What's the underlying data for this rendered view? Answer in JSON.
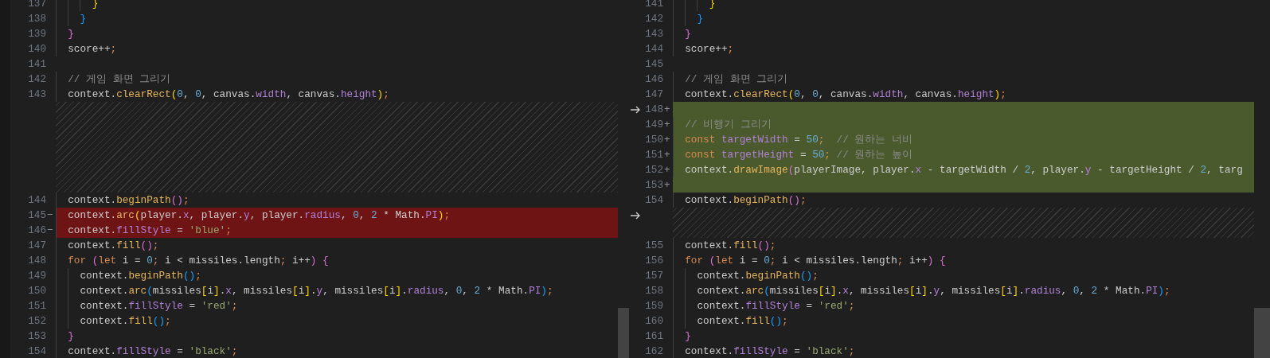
{
  "panes": [
    {
      "kind": "original",
      "lines": [
        {
          "kind": "code",
          "number": "137",
          "tokens": [
            {
              "text": "      }",
              "kind": "bracket_gold"
            }
          ]
        },
        {
          "kind": "code",
          "number": "138",
          "tokens": [
            {
              "text": "    }",
              "kind": "bracket_blue"
            }
          ]
        },
        {
          "kind": "code",
          "number": "139",
          "tokens": [
            {
              "text": "  }",
              "kind": "bracket_pink"
            }
          ]
        },
        {
          "kind": "code",
          "number": "140",
          "tokens": [
            {
              "text": "  score++",
              "kind": "plain"
            },
            {
              "text": ";",
              "kind": "punctuation"
            }
          ]
        },
        {
          "kind": "code",
          "number": "141"
        },
        {
          "kind": "code",
          "number": "142",
          "tokens": [
            {
              "text": "  // 게임 화면 그리기",
              "kind": "comment"
            }
          ]
        },
        {
          "kind": "code",
          "number": "143",
          "tokens": [
            {
              "text": "  context.",
              "kind": "plain"
            },
            {
              "text": "clearRect",
              "kind": "function"
            },
            {
              "text": "(",
              "kind": "bracket_gold"
            },
            {
              "text": "0",
              "kind": "number"
            },
            {
              "text": ", ",
              "kind": "plain"
            },
            {
              "text": "0",
              "kind": "number"
            },
            {
              "text": ", canvas.",
              "kind": "plain"
            },
            {
              "text": "width",
              "kind": "property"
            },
            {
              "text": ", canvas.",
              "kind": "plain"
            },
            {
              "text": "height",
              "kind": "property"
            },
            {
              "text": ")",
              "kind": "bracket_gold"
            },
            {
              "text": ";",
              "kind": "punctuation"
            }
          ]
        },
        {
          "kind": "filler"
        },
        {
          "kind": "filler"
        },
        {
          "kind": "filler"
        },
        {
          "kind": "filler"
        },
        {
          "kind": "filler"
        },
        {
          "kind": "filler"
        },
        {
          "kind": "code",
          "number": "144",
          "tokens": [
            {
              "text": "  context.",
              "kind": "plain"
            },
            {
              "text": "beginPath",
              "kind": "function"
            },
            {
              "text": "()",
              "kind": "bracket_pink"
            },
            {
              "text": ";",
              "kind": "punctuation"
            }
          ]
        },
        {
          "kind": "removed",
          "number": "145",
          "marker": "−",
          "tokens": [
            {
              "text": "  context.",
              "kind": "plain"
            },
            {
              "text": "arc",
              "kind": "function"
            },
            {
              "text": "(",
              "kind": "bracket_gold"
            },
            {
              "text": "player.",
              "kind": "plain"
            },
            {
              "text": "x",
              "kind": "property"
            },
            {
              "text": ", player.",
              "kind": "plain"
            },
            {
              "text": "y",
              "kind": "property"
            },
            {
              "text": ", player.",
              "kind": "plain"
            },
            {
              "text": "radius",
              "kind": "property"
            },
            {
              "text": ", ",
              "kind": "plain"
            },
            {
              "text": "0",
              "kind": "number"
            },
            {
              "text": ", ",
              "kind": "plain"
            },
            {
              "text": "2",
              "kind": "number"
            },
            {
              "text": " * Math.",
              "kind": "plain"
            },
            {
              "text": "PI",
              "kind": "property"
            },
            {
              "text": ")",
              "kind": "bracket_gold"
            },
            {
              "text": ";",
              "kind": "punctuation"
            }
          ]
        },
        {
          "kind": "removed",
          "number": "146",
          "marker": "−",
          "tokens": [
            {
              "text": "  context.",
              "kind": "plain"
            },
            {
              "text": "fillStyle",
              "kind": "property"
            },
            {
              "text": " = ",
              "kind": "plain"
            },
            {
              "text": "'blue'",
              "kind": "string"
            },
            {
              "text": ";",
              "kind": "punctuation"
            }
          ]
        },
        {
          "kind": "code",
          "number": "147",
          "tokens": [
            {
              "text": "  context.",
              "kind": "plain"
            },
            {
              "text": "fill",
              "kind": "function"
            },
            {
              "text": "()",
              "kind": "bracket_pink"
            },
            {
              "text": ";",
              "kind": "punctuation"
            }
          ]
        },
        {
          "kind": "code",
          "number": "148",
          "tokens": [
            {
              "text": "  for",
              "kind": "keyword"
            },
            {
              "text": " (",
              "kind": "bracket_pink"
            },
            {
              "text": "let",
              "kind": "keyword"
            },
            {
              "text": " i = ",
              "kind": "plain"
            },
            {
              "text": "0",
              "kind": "number"
            },
            {
              "text": ";",
              "kind": "punctuation"
            },
            {
              "text": " i < missiles.length",
              "kind": "plain"
            },
            {
              "text": ";",
              "kind": "punctuation"
            },
            {
              "text": " i++",
              "kind": "plain"
            },
            {
              "text": ")",
              "kind": "bracket_pink"
            },
            {
              "text": " {",
              "kind": "bracket_pink"
            }
          ]
        },
        {
          "kind": "code",
          "number": "149",
          "tokens": [
            {
              "text": "    context.",
              "kind": "plain"
            },
            {
              "text": "beginPath",
              "kind": "function"
            },
            {
              "text": "()",
              "kind": "bracket_blue"
            },
            {
              "text": ";",
              "kind": "punctuation"
            }
          ]
        },
        {
          "kind": "code",
          "number": "150",
          "tokens": [
            {
              "text": "    context.",
              "kind": "plain"
            },
            {
              "text": "arc",
              "kind": "function"
            },
            {
              "text": "(",
              "kind": "bracket_blue"
            },
            {
              "text": "missiles",
              "kind": "plain"
            },
            {
              "text": "[",
              "kind": "bracket_gold"
            },
            {
              "text": "i",
              "kind": "plain"
            },
            {
              "text": "]",
              "kind": "bracket_gold"
            },
            {
              "text": ".",
              "kind": "plain"
            },
            {
              "text": "x",
              "kind": "property"
            },
            {
              "text": ", missiles",
              "kind": "plain"
            },
            {
              "text": "[",
              "kind": "bracket_gold"
            },
            {
              "text": "i",
              "kind": "plain"
            },
            {
              "text": "]",
              "kind": "bracket_gold"
            },
            {
              "text": ".",
              "kind": "plain"
            },
            {
              "text": "y",
              "kind": "property"
            },
            {
              "text": ", missiles",
              "kind": "plain"
            },
            {
              "text": "[",
              "kind": "bracket_gold"
            },
            {
              "text": "i",
              "kind": "plain"
            },
            {
              "text": "]",
              "kind": "bracket_gold"
            },
            {
              "text": ".",
              "kind": "plain"
            },
            {
              "text": "radius",
              "kind": "property"
            },
            {
              "text": ", ",
              "kind": "plain"
            },
            {
              "text": "0",
              "kind": "number"
            },
            {
              "text": ", ",
              "kind": "plain"
            },
            {
              "text": "2",
              "kind": "number"
            },
            {
              "text": " * Math.",
              "kind": "plain"
            },
            {
              "text": "PI",
              "kind": "property"
            },
            {
              "text": ")",
              "kind": "bracket_blue"
            },
            {
              "text": ";",
              "kind": "punctuation"
            }
          ]
        },
        {
          "kind": "code",
          "number": "151",
          "tokens": [
            {
              "text": "    context.",
              "kind": "plain"
            },
            {
              "text": "fillStyle",
              "kind": "property"
            },
            {
              "text": " = ",
              "kind": "plain"
            },
            {
              "text": "'red'",
              "kind": "string"
            },
            {
              "text": ";",
              "kind": "punctuation"
            }
          ]
        },
        {
          "kind": "code",
          "number": "152",
          "tokens": [
            {
              "text": "    context.",
              "kind": "plain"
            },
            {
              "text": "fill",
              "kind": "function"
            },
            {
              "text": "()",
              "kind": "bracket_blue"
            },
            {
              "text": ";",
              "kind": "punctuation"
            }
          ]
        },
        {
          "kind": "code",
          "number": "153",
          "tokens": [
            {
              "text": "  }",
              "kind": "bracket_pink"
            }
          ]
        },
        {
          "kind": "code",
          "number": "154",
          "tokens": [
            {
              "text": "  context.",
              "kind": "plain"
            },
            {
              "text": "fillStyle",
              "kind": "property"
            },
            {
              "text": " = ",
              "kind": "plain"
            },
            {
              "text": "'black'",
              "kind": "string"
            },
            {
              "text": ";",
              "kind": "punctuation"
            }
          ]
        }
      ]
    },
    {
      "kind": "modified",
      "lines": [
        {
          "kind": "code",
          "number": "141",
          "tokens": [
            {
              "text": "      }",
              "kind": "bracket_gold"
            }
          ]
        },
        {
          "kind": "code",
          "number": "142",
          "tokens": [
            {
              "text": "    }",
              "kind": "bracket_blue"
            }
          ]
        },
        {
          "kind": "code",
          "number": "143",
          "tokens": [
            {
              "text": "  }",
              "kind": "bracket_pink"
            }
          ]
        },
        {
          "kind": "code",
          "number": "144",
          "tokens": [
            {
              "text": "  score++",
              "kind": "plain"
            },
            {
              "text": ";",
              "kind": "punctuation"
            }
          ]
        },
        {
          "kind": "code",
          "number": "145"
        },
        {
          "kind": "code",
          "number": "146",
          "tokens": [
            {
              "text": "  // 게임 화면 그리기",
              "kind": "comment"
            }
          ]
        },
        {
          "kind": "code",
          "number": "147",
          "tokens": [
            {
              "text": "  context.",
              "kind": "plain"
            },
            {
              "text": "clearRect",
              "kind": "function"
            },
            {
              "text": "(",
              "kind": "bracket_gold"
            },
            {
              "text": "0",
              "kind": "number"
            },
            {
              "text": ", ",
              "kind": "plain"
            },
            {
              "text": "0",
              "kind": "number"
            },
            {
              "text": ", canvas.",
              "kind": "plain"
            },
            {
              "text": "width",
              "kind": "property"
            },
            {
              "text": ", canvas.",
              "kind": "plain"
            },
            {
              "text": "height",
              "kind": "property"
            },
            {
              "text": ")",
              "kind": "bracket_gold"
            },
            {
              "text": ";",
              "kind": "punctuation"
            }
          ]
        },
        {
          "kind": "added",
          "number": "148",
          "marker": "+",
          "revert_arrow": true
        },
        {
          "kind": "added",
          "number": "149",
          "marker": "+",
          "tokens": [
            {
              "text": "  // 비행기 그리기",
              "kind": "comment"
            }
          ]
        },
        {
          "kind": "added",
          "number": "150",
          "marker": "+",
          "tokens": [
            {
              "text": "  const",
              "kind": "keyword"
            },
            {
              "text": " targetWidth",
              "kind": "property"
            },
            {
              "text": " = ",
              "kind": "plain"
            },
            {
              "text": "50",
              "kind": "number"
            },
            {
              "text": ";",
              "kind": "punctuation"
            },
            {
              "text": "  // 원하는 너비",
              "kind": "comment"
            }
          ]
        },
        {
          "kind": "added",
          "number": "151",
          "marker": "+",
          "tokens": [
            {
              "text": "  const",
              "kind": "keyword"
            },
            {
              "text": " targetHeight",
              "kind": "property"
            },
            {
              "text": " = ",
              "kind": "plain"
            },
            {
              "text": "50",
              "kind": "number"
            },
            {
              "text": ";",
              "kind": "punctuation"
            },
            {
              "text": " // 원하는 높이",
              "kind": "comment"
            }
          ]
        },
        {
          "kind": "added",
          "number": "152",
          "marker": "+",
          "tokens": [
            {
              "text": "  context.",
              "kind": "plain"
            },
            {
              "text": "drawImage",
              "kind": "function"
            },
            {
              "text": "(",
              "kind": "bracket_pink"
            },
            {
              "text": "playerImage, player.",
              "kind": "plain"
            },
            {
              "text": "x",
              "kind": "property"
            },
            {
              "text": " - targetWidth / ",
              "kind": "plain"
            },
            {
              "text": "2",
              "kind": "number"
            },
            {
              "text": ", player.",
              "kind": "plain"
            },
            {
              "text": "y",
              "kind": "property"
            },
            {
              "text": " - targetHeight / ",
              "kind": "plain"
            },
            {
              "text": "2",
              "kind": "number"
            },
            {
              "text": ", targ",
              "kind": "plain"
            }
          ]
        },
        {
          "kind": "added",
          "number": "153",
          "marker": "+"
        },
        {
          "kind": "code",
          "number": "154",
          "tokens": [
            {
              "text": "  context.",
              "kind": "plain"
            },
            {
              "text": "beginPath",
              "kind": "function"
            },
            {
              "text": "()",
              "kind": "bracket_pink"
            },
            {
              "text": ";",
              "kind": "punctuation"
            }
          ]
        },
        {
          "kind": "filler",
          "revert_arrow": true
        },
        {
          "kind": "filler"
        },
        {
          "kind": "code",
          "number": "155",
          "tokens": [
            {
              "text": "  context.",
              "kind": "plain"
            },
            {
              "text": "fill",
              "kind": "function"
            },
            {
              "text": "()",
              "kind": "bracket_pink"
            },
            {
              "text": ";",
              "kind": "punctuation"
            }
          ]
        },
        {
          "kind": "code",
          "number": "156",
          "tokens": [
            {
              "text": "  for",
              "kind": "keyword"
            },
            {
              "text": " (",
              "kind": "bracket_pink"
            },
            {
              "text": "let",
              "kind": "keyword"
            },
            {
              "text": " i = ",
              "kind": "plain"
            },
            {
              "text": "0",
              "kind": "number"
            },
            {
              "text": ";",
              "kind": "punctuation"
            },
            {
              "text": " i < missiles.length",
              "kind": "plain"
            },
            {
              "text": ";",
              "kind": "punctuation"
            },
            {
              "text": " i++",
              "kind": "plain"
            },
            {
              "text": ")",
              "kind": "bracket_pink"
            },
            {
              "text": " {",
              "kind": "bracket_pink"
            }
          ]
        },
        {
          "kind": "code",
          "number": "157",
          "tokens": [
            {
              "text": "    context.",
              "kind": "plain"
            },
            {
              "text": "beginPath",
              "kind": "function"
            },
            {
              "text": "()",
              "kind": "bracket_blue"
            },
            {
              "text": ";",
              "kind": "punctuation"
            }
          ]
        },
        {
          "kind": "code",
          "number": "158",
          "tokens": [
            {
              "text": "    context.",
              "kind": "plain"
            },
            {
              "text": "arc",
              "kind": "function"
            },
            {
              "text": "(",
              "kind": "bracket_blue"
            },
            {
              "text": "missiles",
              "kind": "plain"
            },
            {
              "text": "[",
              "kind": "bracket_gold"
            },
            {
              "text": "i",
              "kind": "plain"
            },
            {
              "text": "]",
              "kind": "bracket_gold"
            },
            {
              "text": ".",
              "kind": "plain"
            },
            {
              "text": "x",
              "kind": "property"
            },
            {
              "text": ", missiles",
              "kind": "plain"
            },
            {
              "text": "[",
              "kind": "bracket_gold"
            },
            {
              "text": "i",
              "kind": "plain"
            },
            {
              "text": "]",
              "kind": "bracket_gold"
            },
            {
              "text": ".",
              "kind": "plain"
            },
            {
              "text": "y",
              "kind": "property"
            },
            {
              "text": ", missiles",
              "kind": "plain"
            },
            {
              "text": "[",
              "kind": "bracket_gold"
            },
            {
              "text": "i",
              "kind": "plain"
            },
            {
              "text": "]",
              "kind": "bracket_gold"
            },
            {
              "text": ".",
              "kind": "plain"
            },
            {
              "text": "radius",
              "kind": "property"
            },
            {
              "text": ", ",
              "kind": "plain"
            },
            {
              "text": "0",
              "kind": "number"
            },
            {
              "text": ", ",
              "kind": "plain"
            },
            {
              "text": "2",
              "kind": "number"
            },
            {
              "text": " * Math.",
              "kind": "plain"
            },
            {
              "text": "PI",
              "kind": "property"
            },
            {
              "text": ")",
              "kind": "bracket_blue"
            },
            {
              "text": ";",
              "kind": "punctuation"
            }
          ]
        },
        {
          "kind": "code",
          "number": "159",
          "tokens": [
            {
              "text": "    context.",
              "kind": "plain"
            },
            {
              "text": "fillStyle",
              "kind": "property"
            },
            {
              "text": " = ",
              "kind": "plain"
            },
            {
              "text": "'red'",
              "kind": "string"
            },
            {
              "text": ";",
              "kind": "punctuation"
            }
          ]
        },
        {
          "kind": "code",
          "number": "160",
          "tokens": [
            {
              "text": "    context.",
              "kind": "plain"
            },
            {
              "text": "fill",
              "kind": "function"
            },
            {
              "text": "()",
              "kind": "bracket_blue"
            },
            {
              "text": ";",
              "kind": "punctuation"
            }
          ]
        },
        {
          "kind": "code",
          "number": "161",
          "tokens": [
            {
              "text": "  }",
              "kind": "bracket_pink"
            }
          ]
        },
        {
          "kind": "code",
          "number": "162",
          "tokens": [
            {
              "text": "  context.",
              "kind": "plain"
            },
            {
              "text": "fillStyle",
              "kind": "property"
            },
            {
              "text": " = ",
              "kind": "plain"
            },
            {
              "text": "'black'",
              "kind": "string"
            },
            {
              "text": ";",
              "kind": "punctuation"
            }
          ]
        }
      ]
    }
  ]
}
